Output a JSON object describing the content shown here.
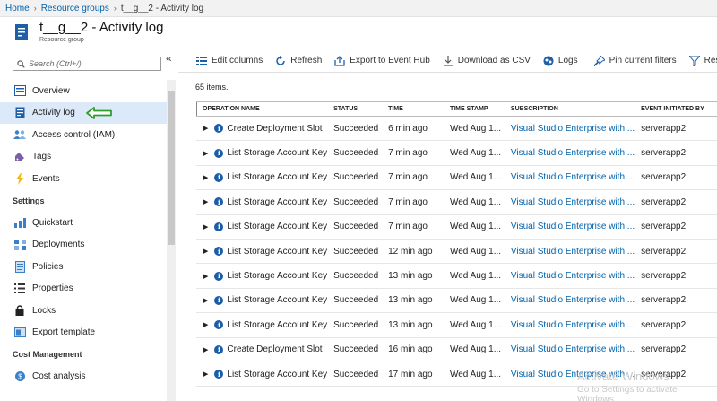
{
  "breadcrumb": {
    "items": [
      "Home",
      "Resource groups",
      "t__g__2 - Activity log"
    ]
  },
  "header": {
    "title": "t__g__2 - Activity log",
    "subtitle": "Resource group"
  },
  "sidebar": {
    "search_placeholder": "Search (Ctrl+/)",
    "collapse_glyph": "«",
    "items": [
      {
        "label": "Overview",
        "icon": "overview-icon"
      },
      {
        "label": "Activity log",
        "icon": "activity-log-icon",
        "active": true
      },
      {
        "label": "Access control (IAM)",
        "icon": "people-icon"
      },
      {
        "label": "Tags",
        "icon": "tag-icon"
      },
      {
        "label": "Events",
        "icon": "lightning-icon"
      }
    ],
    "section_settings": "Settings",
    "settings_items": [
      {
        "label": "Quickstart",
        "icon": "quickstart-icon"
      },
      {
        "label": "Deployments",
        "icon": "deployments-icon"
      },
      {
        "label": "Policies",
        "icon": "policies-icon"
      },
      {
        "label": "Properties",
        "icon": "properties-icon"
      },
      {
        "label": "Locks",
        "icon": "lock-icon"
      },
      {
        "label": "Export template",
        "icon": "export-template-icon"
      }
    ],
    "section_cost": "Cost Management",
    "cost_items": [
      {
        "label": "Cost analysis",
        "icon": "cost-analysis-icon"
      }
    ]
  },
  "toolbar": {
    "edit_columns": "Edit columns",
    "refresh": "Refresh",
    "export_event_hub": "Export to Event Hub",
    "download_csv": "Download as CSV",
    "logs": "Logs",
    "pin_filters": "Pin current filters",
    "reset": "Rese"
  },
  "content": {
    "count": "65 items.",
    "columns": [
      "OPERATION NAME",
      "STATUS",
      "TIME",
      "TIME STAMP",
      "SUBSCRIPTION",
      "EVENT INITIATED BY"
    ],
    "rows": [
      [
        "Create Deployment Slot",
        "Succeeded",
        "6 min ago",
        "Wed Aug 1...",
        "Visual Studio Enterprise with ...",
        "serverapp2"
      ],
      [
        "List Storage Account Key",
        "Succeeded",
        "7 min ago",
        "Wed Aug 1...",
        "Visual Studio Enterprise with ...",
        "serverapp2"
      ],
      [
        "List Storage Account Key",
        "Succeeded",
        "7 min ago",
        "Wed Aug 1...",
        "Visual Studio Enterprise with ...",
        "serverapp2"
      ],
      [
        "List Storage Account Key",
        "Succeeded",
        "7 min ago",
        "Wed Aug 1...",
        "Visual Studio Enterprise with ...",
        "serverapp2"
      ],
      [
        "List Storage Account Key",
        "Succeeded",
        "7 min ago",
        "Wed Aug 1...",
        "Visual Studio Enterprise with ...",
        "serverapp2"
      ],
      [
        "List Storage Account Key",
        "Succeeded",
        "12 min ago",
        "Wed Aug 1...",
        "Visual Studio Enterprise with ...",
        "serverapp2"
      ],
      [
        "List Storage Account Key",
        "Succeeded",
        "13 min ago",
        "Wed Aug 1...",
        "Visual Studio Enterprise with ...",
        "serverapp2"
      ],
      [
        "List Storage Account Key",
        "Succeeded",
        "13 min ago",
        "Wed Aug 1...",
        "Visual Studio Enterprise with ...",
        "serverapp2"
      ],
      [
        "List Storage Account Key",
        "Succeeded",
        "13 min ago",
        "Wed Aug 1...",
        "Visual Studio Enterprise with ...",
        "serverapp2"
      ],
      [
        "Create Deployment Slot",
        "Succeeded",
        "16 min ago",
        "Wed Aug 1...",
        "Visual Studio Enterprise with ...",
        "serverapp2"
      ],
      [
        "List Storage Account Key",
        "Succeeded",
        "17 min ago",
        "Wed Aug 1...",
        "Visual Studio Enterprise with ...",
        "serverapp2"
      ]
    ]
  },
  "watermark": {
    "line1": "Activate Windows",
    "line2": "Go to Settings to activate Windows."
  },
  "colors": {
    "link": "#0062ad",
    "active_nav": "#dbe9f8",
    "info_icon": "#1a5ea8",
    "indicator_arrow": "#2e9e2e"
  }
}
